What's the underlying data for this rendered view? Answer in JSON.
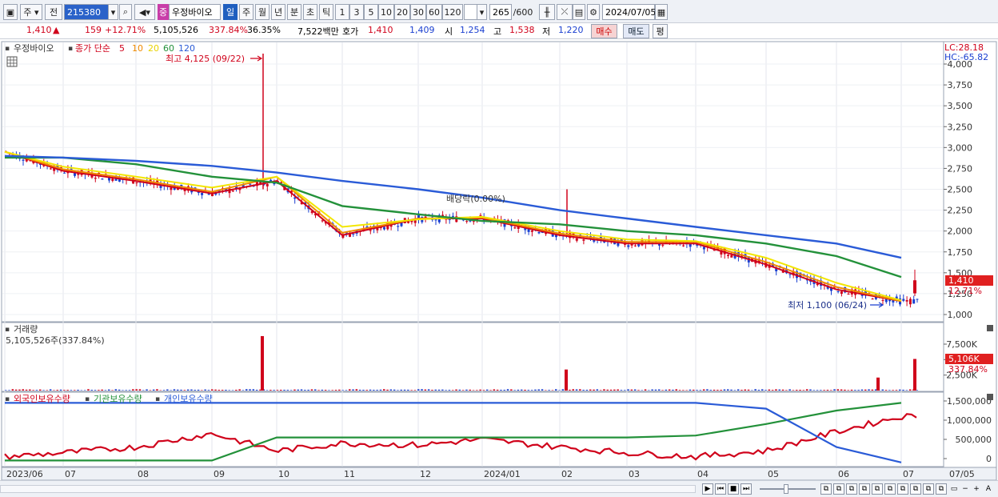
{
  "toolbar": {
    "market": "주",
    "market_type": "전",
    "code": "215380",
    "badge": "중",
    "stock_name": "우정바이오",
    "periods": [
      "일",
      "주",
      "월",
      "년",
      "분",
      "초",
      "틱"
    ],
    "intervals": [
      "1",
      "3",
      "5",
      "10",
      "20",
      "30",
      "60",
      "120"
    ],
    "count": "265",
    "count_total": "/600",
    "date": "2024/07/05"
  },
  "quote": {
    "price": "1,410",
    "arrow": "▲",
    "change": "159",
    "change_pct": "+12.71%",
    "volume": "5,105,526",
    "volume_pct": "337.84%",
    "turnover": "36.35%",
    "amount": "7,522백만",
    "hoga_label": "호가",
    "ask": "1,410",
    "bid": "1,409",
    "open_label": "시",
    "open": "1,254",
    "high_label": "고",
    "high": "1,538",
    "low_label": "저",
    "low": "1,220",
    "buy": "매수",
    "sell": "매도",
    "avg": "평"
  },
  "price_panel": {
    "name": "우정바이오",
    "legend_prefix": "종가 단순",
    "ma_labels": [
      "5",
      "10",
      "20",
      "60",
      "120"
    ],
    "ma_colors": [
      "#d0021b",
      "#f08a00",
      "#f2e600",
      "#23913a",
      "#2a5bd7"
    ],
    "high_note": "최고 4,125 (09/22)",
    "low_note": "최저 1,100 (06/24)",
    "dividend_note": "배당락(0.00%)",
    "lc": "LC:28.18",
    "hc": "HC:-65.82",
    "current_tag": "1,410",
    "current_pct": "12.71%"
  },
  "volume_panel": {
    "title": "거래량",
    "value_text": "5,105,526주(337.84%)",
    "current_tag": "5,106K",
    "current_pct": "337.84%"
  },
  "holdings_panel": {
    "labels": [
      "외국인보유수량",
      "기관보유수량",
      "개인보유수량"
    ],
    "colors": [
      "#d0021b",
      "#23913a",
      "#2a5bd7"
    ]
  },
  "x_axis": [
    "2023/06",
    "07",
    "08",
    "09",
    "10",
    "11",
    "12",
    "2024/01",
    "02",
    "03",
    "04",
    "05",
    "06",
    "07"
  ],
  "x_axis_right": "07/05",
  "chart_data": [
    {
      "type": "line",
      "title": "우정바이오",
      "ylim": [
        1000,
        4125
      ],
      "y_ticks": [
        "4,000",
        "3,750",
        "3,500",
        "3,250",
        "3,000",
        "2,750",
        "2,500",
        "2,250",
        "2,000",
        "1,750",
        "1,500",
        "1,250",
        "1,000"
      ],
      "x": [
        "2023/06",
        "07",
        "08",
        "09",
        "10",
        "11",
        "12",
        "2024/01",
        "02",
        "03",
        "04",
        "05",
        "06",
        "07"
      ],
      "series": [
        {
          "name": "5",
          "values": [
            2950,
            2720,
            2600,
            2450,
            2600,
            1950,
            2150,
            2150,
            1950,
            1850,
            1850,
            1600,
            1300,
            1160
          ]
        },
        {
          "name": "10",
          "values": [
            2950,
            2740,
            2620,
            2470,
            2650,
            1980,
            2150,
            2160,
            1970,
            1870,
            1870,
            1630,
            1330,
            1160
          ]
        },
        {
          "name": "20",
          "values": [
            2950,
            2770,
            2650,
            2520,
            2650,
            2050,
            2140,
            2170,
            2000,
            1900,
            1880,
            1680,
            1380,
            1170
          ]
        },
        {
          "name": "60",
          "values": [
            2880,
            2880,
            2800,
            2650,
            2580,
            2300,
            2200,
            2120,
            2080,
            2000,
            1950,
            1850,
            1700,
            1450
          ]
        },
        {
          "name": "120",
          "values": [
            2900,
            2880,
            2840,
            2780,
            2700,
            2600,
            2500,
            2400,
            2250,
            2150,
            2050,
            1950,
            1850,
            1680
          ]
        }
      ]
    },
    {
      "type": "bar",
      "title": "거래량",
      "y_ticks": [
        "7,500K",
        "5,000K",
        "2,500K"
      ],
      "ylim": [
        0,
        9000
      ],
      "categories": [
        "2023/06",
        "07",
        "08",
        "09",
        "10",
        "11",
        "12",
        "2024/01",
        "02",
        "03",
        "04",
        "05",
        "06",
        "07"
      ],
      "spikes_k": [
        {
          "x": "09",
          "value": 8800
        },
        {
          "x": "02",
          "value": 3400
        },
        {
          "x": "06",
          "value": 2100
        },
        {
          "x": "07",
          "value": 5106
        }
      ]
    },
    {
      "type": "line",
      "title": "보유수량",
      "y_ticks": [
        "1,500,000",
        "1,000,000",
        "500,000",
        "0"
      ],
      "ylim": [
        -150000,
        1600000
      ],
      "x": [
        "2023/06",
        "07",
        "08",
        "09",
        "10",
        "11",
        "12",
        "2024/01",
        "02",
        "03",
        "04",
        "05",
        "06",
        "07"
      ],
      "series": [
        {
          "name": "외국인보유수량",
          "values": [
            50000,
            150000,
            300000,
            650000,
            200000,
            400000,
            350000,
            500000,
            300000,
            150000,
            50000,
            200000,
            700000,
            1100000
          ]
        },
        {
          "name": "기관보유수량",
          "values": [
            -50000,
            -50000,
            -50000,
            -50000,
            550000,
            550000,
            550000,
            550000,
            550000,
            550000,
            600000,
            900000,
            1250000,
            1450000
          ]
        },
        {
          "name": "개인보유수량",
          "values": [
            1450000,
            1450000,
            1450000,
            1450000,
            1450000,
            1450000,
            1450000,
            1450000,
            1450000,
            1450000,
            1450000,
            1300000,
            300000,
            -100000
          ]
        }
      ]
    }
  ]
}
